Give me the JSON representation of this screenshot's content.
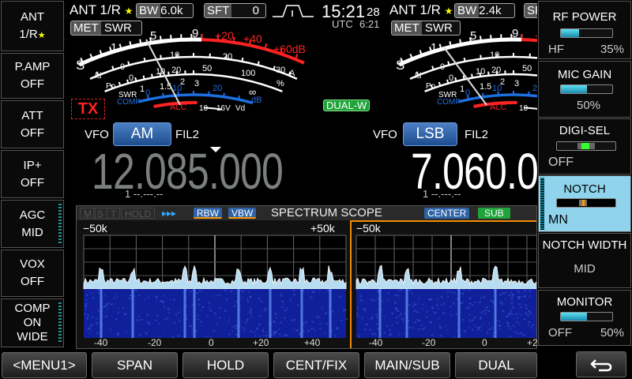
{
  "left_buttons": [
    {
      "l1": "ANT",
      "l2": "1/R",
      "star": "★"
    },
    {
      "l1": "P.AMP",
      "l2": "OFF"
    },
    {
      "l1": "ATT",
      "l2": "OFF"
    },
    {
      "l1": "IP+",
      "l2": "OFF"
    },
    {
      "l1": "AGC",
      "l2": "MID"
    },
    {
      "l1": "VOX",
      "l2": "OFF"
    },
    {
      "l1": "COMP",
      "l2": "ON",
      "l3": "WIDE"
    }
  ],
  "bottom_buttons": [
    "<MENU1>",
    "SPAN",
    "HOLD",
    "CENT/FIX",
    "MAIN/SUB",
    "DUAL"
  ],
  "back_icon": "return-arrow-icon",
  "right_panel": {
    "rf_power": {
      "title": "RF POWER",
      "band": "HF",
      "value": "35%",
      "level": 35
    },
    "mic_gain": {
      "title": "MIC GAIN",
      "value": "50%",
      "level": 50
    },
    "digi_sel": {
      "title": "DIGI-SEL",
      "value": "OFF"
    },
    "notch": {
      "title": "NOTCH",
      "value": "MN"
    },
    "notch_width": {
      "title": "NOTCH WIDTH",
      "value": "MID"
    },
    "monitor": {
      "title": "MONITOR",
      "state": "OFF",
      "value": "50%",
      "level": 50
    }
  },
  "clock": {
    "time": "15:21",
    "seconds": "28",
    "utc_label": "UTC",
    "utc_time": "6:21"
  },
  "main": {
    "ant": "ANT 1/R",
    "star": "★",
    "bw_label": "BW",
    "bw": "6.0k",
    "sft_label": "SFT",
    "sft": "0",
    "met_label": "MET",
    "met": "SWR",
    "tx": "TX",
    "vfo": "VFO",
    "mode": "AM",
    "filter": "FIL2",
    "frequency": "12.085.000",
    "memory": "1 --.---.--"
  },
  "sub": {
    "ant": "ANT 1/R",
    "star": "★",
    "bw_label": "BW",
    "bw": "2.4k",
    "sft_label": "SF",
    "met_label": "MET",
    "met": "SWR",
    "dual": "DUAL-W",
    "vfo": "VFO",
    "mode": "LSB",
    "filter": "FIL2",
    "frequency": "7.060.0",
    "memory": "1 --.---.--"
  },
  "meter": {
    "s": "S",
    "s1": "1",
    "s5": "5",
    "s9": "9",
    "p20": "+20",
    "p40": "+40",
    "p60": "+60dB",
    "id": "Id",
    "id0": "0",
    "id10": "10",
    "id20": "20",
    "id30": "30",
    "ida": "A",
    "po": "Po",
    "po0": "0",
    "po10": "10",
    "po20": "20",
    "po50": "50",
    "po100": "100",
    "pop": "%",
    "swr": "SWR",
    "swr1": "1",
    "swr15": "1.5",
    "swr2": "2",
    "swr3": "3",
    "swrinf": "∞",
    "comp": "COMP",
    "comp0": "0",
    "comp10": "10",
    "comp20": "20",
    "compdb": "dB",
    "alc": "ALC",
    "vd10": "10",
    "vd16": "16V",
    "vd": "Vd"
  },
  "scope": {
    "m": "M",
    "s": "S",
    "t": "T",
    "hold": "HOLD",
    "arrows": "▸▸▸",
    "rbw": "RBW",
    "vbw": "VBW",
    "title": "SPECTRUM SCOPE",
    "center": "CENTER",
    "sub": "SUB",
    "left": {
      "min": "−50k",
      "max": "+50k",
      "ticks": [
        "-40",
        "-20",
        "0",
        "+20",
        "+40"
      ]
    },
    "right": {
      "min": "−50k",
      "ticks": [
        "-40",
        "-20",
        "0",
        "+2"
      ]
    }
  },
  "colors": {
    "accent_blue": "#2e63a8",
    "notch_bg": "#8fd3ec",
    "dual_green": "#1fa33a",
    "scope_border": "#f08c00",
    "red": "#ff1a1a",
    "comp_blue": "#1e6fe0"
  }
}
